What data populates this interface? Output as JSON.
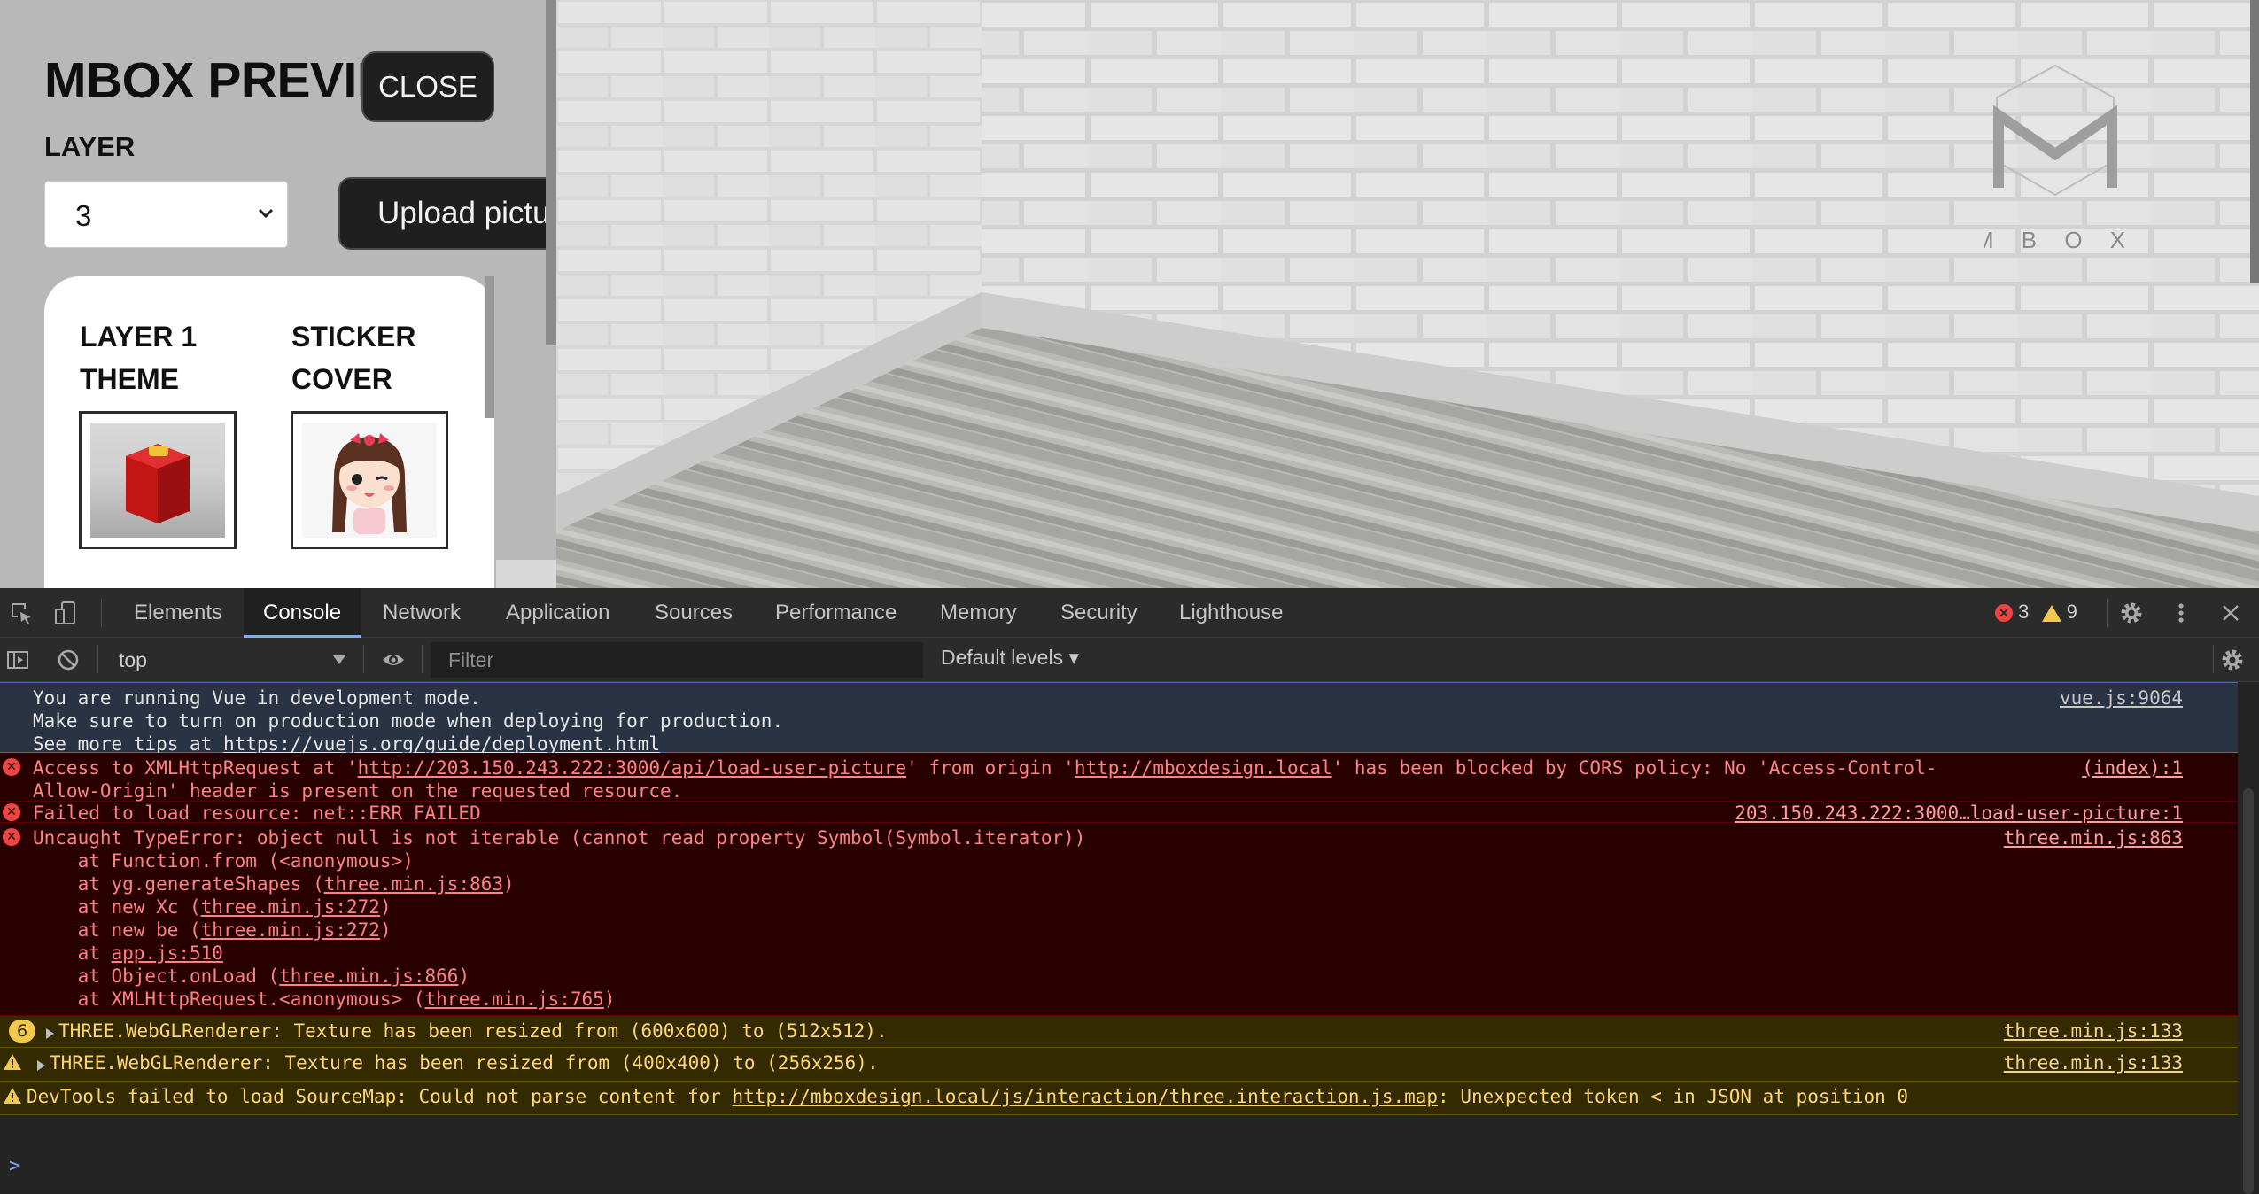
{
  "app": {
    "title": "MBOX PREVIE",
    "close_label": "CLOSE",
    "layer_label": "LAYER",
    "layer_value": "3",
    "upload_label": "Upload pictur",
    "cards": [
      {
        "title": "LAYER 1 THEME"
      },
      {
        "title": "STICKER COVER"
      }
    ],
    "logo_text": "M  B O X"
  },
  "devtools": {
    "tabs": [
      "Elements",
      "Console",
      "Network",
      "Application",
      "Sources",
      "Performance",
      "Memory",
      "Security",
      "Lighthouse"
    ],
    "active_tab": "Console",
    "error_count": "3",
    "warning_count": "9",
    "context": "top",
    "filter_placeholder": "Filter",
    "levels": "Default levels ▾"
  },
  "console": {
    "info": {
      "line1": "You are running Vue in development mode.",
      "line2": "Make sure to turn on production mode when deploying for production.",
      "line3_prefix": "See more tips at ",
      "line3_link": "https://vuejs.org/guide/deployment.html",
      "source": "vue.js:9064"
    },
    "cors": {
      "p1": "Access to XMLHttpRequest at '",
      "link1": "http://203.150.243.222:3000/api/load-user-picture",
      "p2": "' from origin '",
      "link2": "http://mboxdesign.local",
      "p3": "' has been blocked by CORS policy: No 'Access-Control-",
      "line2": "Allow-Origin' header is present on the requested resource.",
      "source": "(index):1"
    },
    "failed": {
      "text": "Failed to load resource: net::ERR_FAILED",
      "source": "203.150.243.222:3000…load-user-picture:1"
    },
    "typeerror": {
      "text": "Uncaught TypeError: object null is not iterable (cannot read property Symbol(Symbol.iterator))",
      "source": "three.min.js:863",
      "stack": [
        {
          "pre": "    at Function.from (<anonymous>)",
          "link": "",
          "post": ""
        },
        {
          "pre": "    at yg.generateShapes (",
          "link": "three.min.js:863",
          "post": ")"
        },
        {
          "pre": "    at new Xc (",
          "link": "three.min.js:272",
          "post": ")"
        },
        {
          "pre": "    at new be (",
          "link": "three.min.js:272",
          "post": ")"
        },
        {
          "pre": "    at ",
          "link": "app.js:510",
          "post": ""
        },
        {
          "pre": "    at Object.onLoad (",
          "link": "three.min.js:866",
          "post": ")"
        },
        {
          "pre": "    at XMLHttpRequest.<anonymous> (",
          "link": "three.min.js:765",
          "post": ")"
        }
      ]
    },
    "warn1": {
      "count": "6",
      "text": "THREE.WebGLRenderer: Texture has been resized from (600x600) to (512x512).",
      "source": "three.min.js:133"
    },
    "warn2": {
      "text": "THREE.WebGLRenderer: Texture has been resized from (400x400) to (256x256).",
      "source": "three.min.js:133"
    },
    "warn3": {
      "p1": "DevTools failed to load SourceMap: Could not parse content for ",
      "link": "http://mboxdesign.local/js/interaction/three.interaction.js.map",
      "p2": ": Unexpected token < in JSON at position 0"
    },
    "prompt": ">"
  }
}
